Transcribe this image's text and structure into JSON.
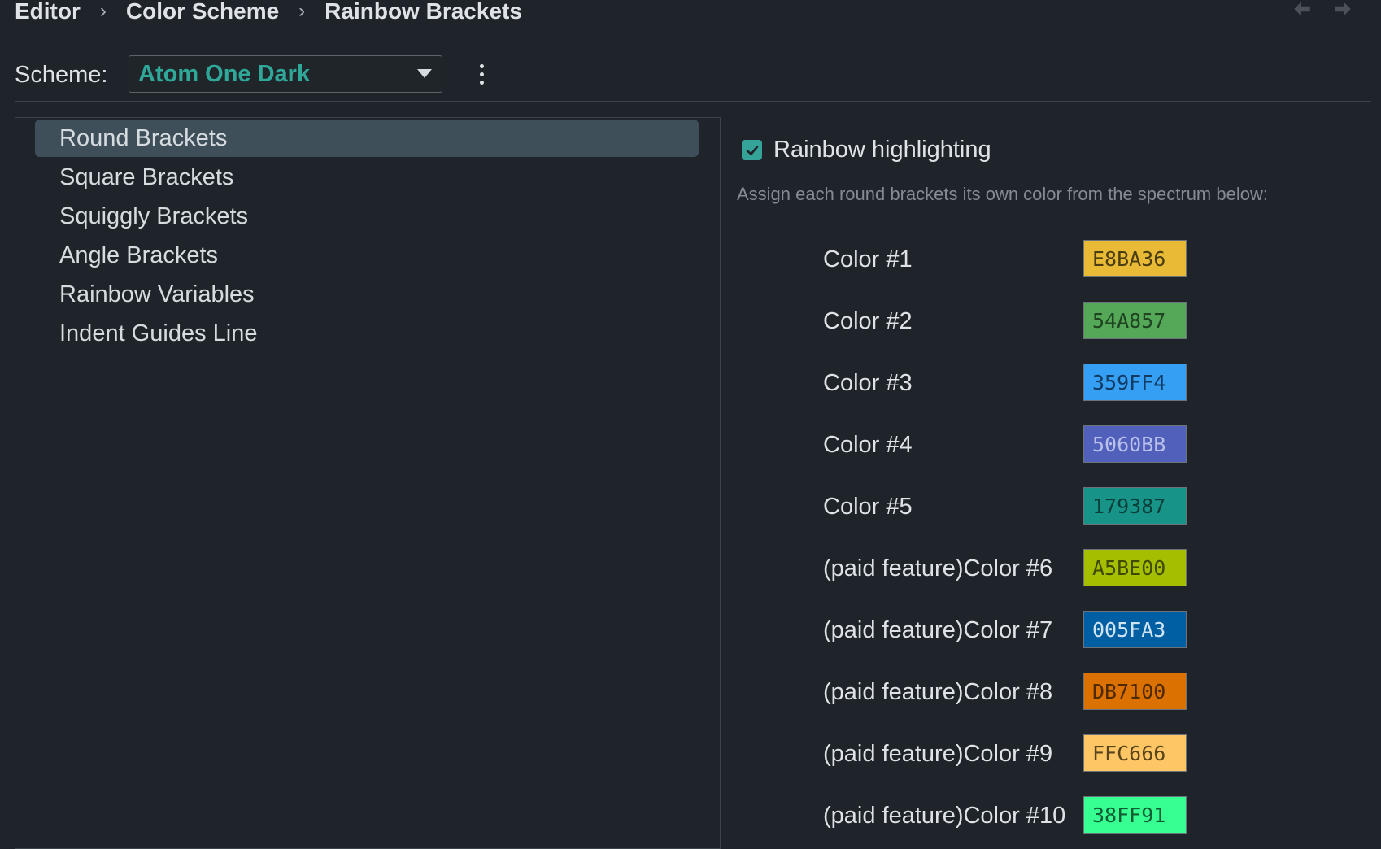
{
  "breadcrumb": {
    "items": [
      "Editor",
      "Color Scheme",
      "Rainbow Brackets"
    ],
    "separator": "›"
  },
  "nav": {
    "back_icon": "arrow-left-icon",
    "forward_icon": "arrow-right-icon"
  },
  "scheme": {
    "label": "Scheme:",
    "value": "Atom One Dark",
    "more_icon": "kebab-menu-icon"
  },
  "sidebar": {
    "items": [
      {
        "label": "Round Brackets",
        "selected": true
      },
      {
        "label": "Square Brackets",
        "selected": false
      },
      {
        "label": "Squiggly Brackets",
        "selected": false
      },
      {
        "label": "Angle Brackets",
        "selected": false
      },
      {
        "label": "Rainbow Variables",
        "selected": false
      },
      {
        "label": "Indent Guides Line",
        "selected": false
      }
    ]
  },
  "settings": {
    "rainbow_label": "Rainbow highlighting",
    "rainbow_checked": true,
    "hint": "Assign each round brackets its own color from the spectrum below:",
    "colors": [
      {
        "name": "Color #1",
        "hex": "E8BA36",
        "swatch": "#E8BA36",
        "text_color": "#4a3d12"
      },
      {
        "name": "Color #2",
        "hex": "54A857",
        "swatch": "#54A857",
        "text_color": "#1f4421"
      },
      {
        "name": "Color #3",
        "hex": "359FF4",
        "swatch": "#359FF4",
        "text_color": "#123b63"
      },
      {
        "name": "Color #4",
        "hex": "5060BB",
        "swatch": "#5060BB",
        "text_color": "#b9c0ea"
      },
      {
        "name": "Color #5",
        "hex": "179387",
        "swatch": "#179387",
        "text_color": "#0a3e39"
      },
      {
        "name": "(paid feature)Color #6",
        "hex": "A5BE00",
        "swatch": "#A5BE00",
        "text_color": "#3f4a00"
      },
      {
        "name": "(paid feature)Color #7",
        "hex": "005FA3",
        "swatch": "#005FA3",
        "text_color": "#cfe3f3"
      },
      {
        "name": "(paid feature)Color #8",
        "hex": "DB7100",
        "swatch": "#DB7100",
        "text_color": "#4f2a00"
      },
      {
        "name": "(paid feature)Color #9",
        "hex": "FFC666",
        "swatch": "#FFC666",
        "text_color": "#5a4419"
      },
      {
        "name": "(paid feature)Color #10",
        "hex": "38FF91",
        "swatch": "#38FF91",
        "text_color": "#115c33"
      }
    ]
  }
}
